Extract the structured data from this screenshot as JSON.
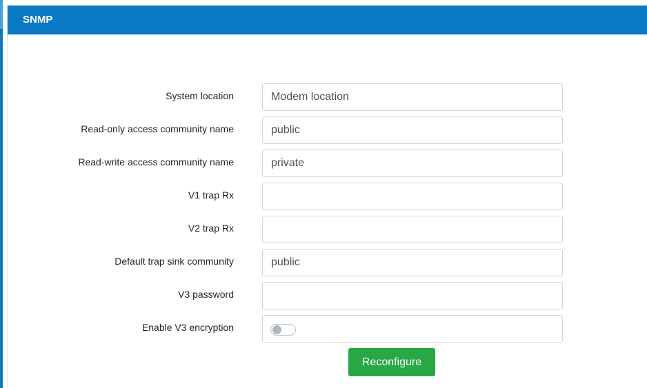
{
  "panel": {
    "title": "SNMP"
  },
  "form": {
    "fields": [
      {
        "label": "System location",
        "value": "Modem location",
        "placeholder": ""
      },
      {
        "label": "Read-only access community name",
        "value": "public",
        "placeholder": ""
      },
      {
        "label": "Read-write access community name",
        "value": "private",
        "placeholder": ""
      },
      {
        "label": "V1 trap Rx",
        "value": "",
        "placeholder": ""
      },
      {
        "label": "V2 trap Rx",
        "value": "",
        "placeholder": ""
      },
      {
        "label": "Default trap sink community",
        "value": "public",
        "placeholder": ""
      },
      {
        "label": "V3 password",
        "value": "",
        "placeholder": ""
      }
    ],
    "encryption": {
      "label": "Enable V3 encryption",
      "enabled": false
    }
  },
  "actions": {
    "reconfigure_label": "Reconfigure"
  },
  "colors": {
    "header": "#0a78c2",
    "button": "#28a745"
  }
}
